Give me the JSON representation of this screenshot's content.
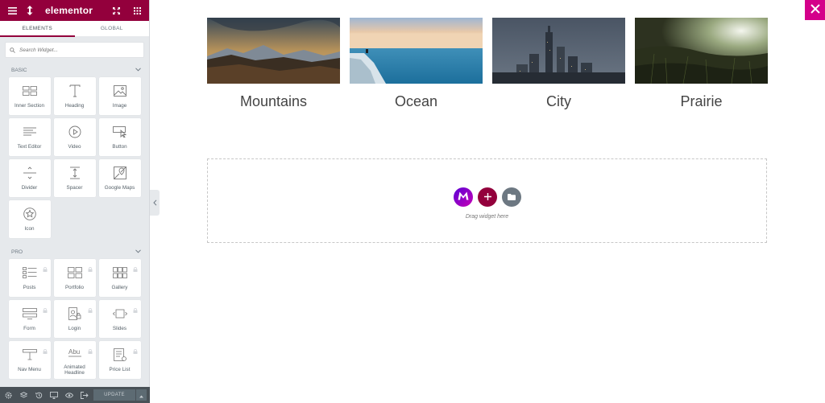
{
  "topbar": {
    "logo": "elementor"
  },
  "tabs": [
    {
      "label": "Elements",
      "active": true
    },
    {
      "label": "Global",
      "active": false
    }
  ],
  "search": {
    "placeholder": "Search Widget..."
  },
  "basic": {
    "heading": "Basic",
    "widgets": [
      {
        "label": "Inner Section",
        "icon": "inner-section-icon"
      },
      {
        "label": "Heading",
        "icon": "heading-icon"
      },
      {
        "label": "Image",
        "icon": "image-icon"
      },
      {
        "label": "Text Editor",
        "icon": "text-editor-icon"
      },
      {
        "label": "Video",
        "icon": "video-icon"
      },
      {
        "label": "Button",
        "icon": "button-icon"
      },
      {
        "label": "Divider",
        "icon": "divider-icon"
      },
      {
        "label": "Spacer",
        "icon": "spacer-icon"
      },
      {
        "label": "Google Maps",
        "icon": "google-maps-icon"
      },
      {
        "label": "Icon",
        "icon": "star-icon"
      }
    ]
  },
  "pro": {
    "heading": "Pro",
    "widgets": [
      {
        "label": "Posts",
        "icon": "posts-icon"
      },
      {
        "label": "Portfolio",
        "icon": "portfolio-icon"
      },
      {
        "label": "Gallery",
        "icon": "gallery-icon"
      },
      {
        "label": "Form",
        "icon": "form-icon"
      },
      {
        "label": "Login",
        "icon": "login-icon"
      },
      {
        "label": "Slides",
        "icon": "slides-icon"
      },
      {
        "label": "Nav Menu",
        "icon": "nav-menu-icon"
      },
      {
        "label": "Animated Headline",
        "icon": "animated-headline-icon"
      },
      {
        "label": "Price List",
        "icon": "price-list-icon"
      }
    ]
  },
  "footer": {
    "update_label": "UPDATE"
  },
  "gallery": [
    {
      "caption": "Mountains"
    },
    {
      "caption": "Ocean"
    },
    {
      "caption": "City"
    },
    {
      "caption": "Prairie"
    }
  ],
  "dropzone": {
    "text": "Drag widget here"
  },
  "colors": {
    "brand": "#93003c",
    "close": "#d4008a",
    "add_button": "#93003c",
    "template_button": "#6d7882",
    "logo_button": "#7a00ff"
  }
}
